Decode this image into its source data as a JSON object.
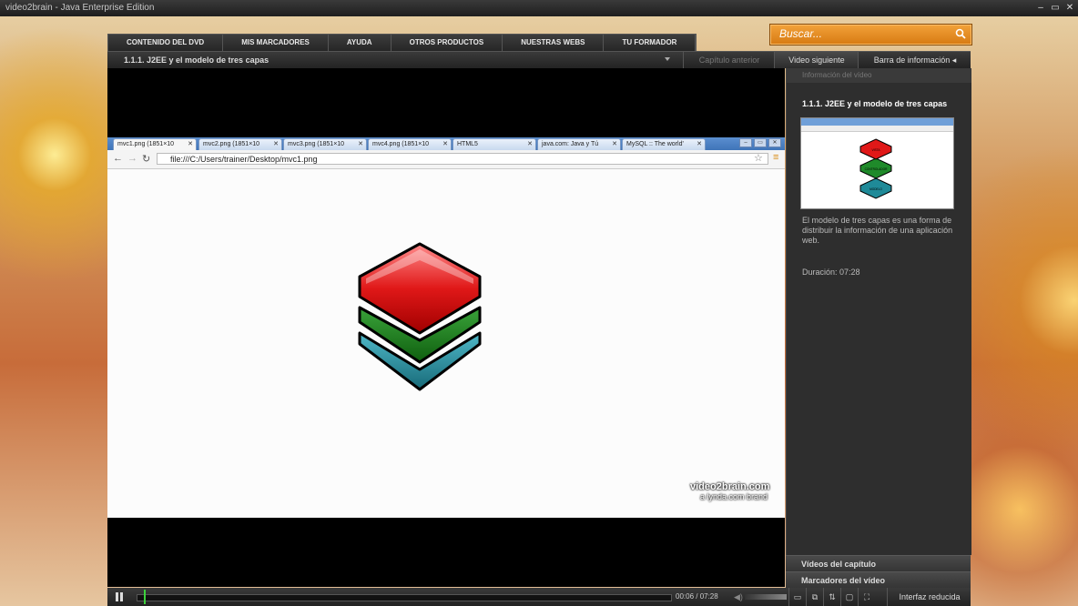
{
  "window": {
    "title": "video2brain - Java Enterprise Edition",
    "buttons": [
      "–",
      "▭",
      "✕"
    ]
  },
  "nav": {
    "items": [
      "CONTENIDO DEL DVD",
      "MIS MARCADORES",
      "AYUDA",
      "OTROS PRODUCTOS",
      "NUESTRAS WEBS",
      "TU FORMADOR"
    ]
  },
  "search": {
    "placeholder": "Buscar..."
  },
  "chapter": {
    "title": "1.1.1. J2EE y el modelo de tres capas",
    "prev": "Capítulo anterior",
    "next": "Video siguiente",
    "info": "Barra de información"
  },
  "browser": {
    "tabs": [
      "mvc1.png (1851×10",
      "mvc2.png (1851×10",
      "mvc3.png (1851×10",
      "mvc4.png (1851×10",
      "HTML5",
      "java.com: Java y Tú",
      "MySQL :: The world'"
    ],
    "url": "file:///C:/Users/trainer/Desktop/mvc1.png"
  },
  "watermark": {
    "line1": "video2brain.com",
    "line2": "a lynda.com brand"
  },
  "thumb_labels": [
    "VISTA",
    "CONTROLADOR",
    "MODELO"
  ],
  "panel": {
    "header": "Información del vídeo",
    "video_title": "1.1.1. J2EE y el modelo de tres capas",
    "description": "El modelo de tres capas es una forma de distribuir la información de una aplicación web.",
    "duration": "Duración: 07:28",
    "chapter_videos": "Vídeos del capítulo",
    "video_bookmarks": "Marcadores del vídeo"
  },
  "player": {
    "time": "00:06 / 07:28",
    "progress": 0.013,
    "reduced": "Interfaz reducida"
  },
  "colors": {
    "accent": "#e08a1e",
    "playhead": "#3cd23c"
  }
}
